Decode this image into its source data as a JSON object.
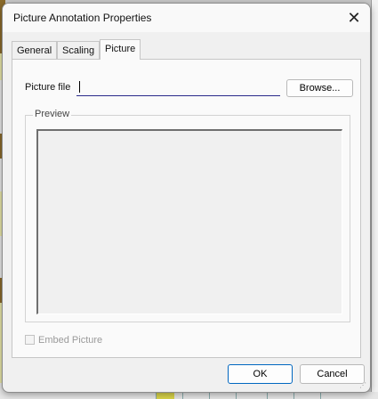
{
  "dialog": {
    "title": "Picture Annotation Properties",
    "close_glyph": "✕"
  },
  "tabs": [
    {
      "label": "General",
      "active": false
    },
    {
      "label": "Scaling",
      "active": false
    },
    {
      "label": "Picture",
      "active": true
    }
  ],
  "picture": {
    "file_label": "Picture file",
    "file_value": "",
    "browse_label": "Browse...",
    "preview_label": "Preview",
    "embed_label": "Embed Picture",
    "embed_checked": false,
    "embed_enabled": false
  },
  "footer": {
    "ok_label": "OK",
    "cancel_label": "Cancel"
  },
  "colors": {
    "accent": "#0067c0",
    "dialog_bg": "#f0f0f0"
  }
}
